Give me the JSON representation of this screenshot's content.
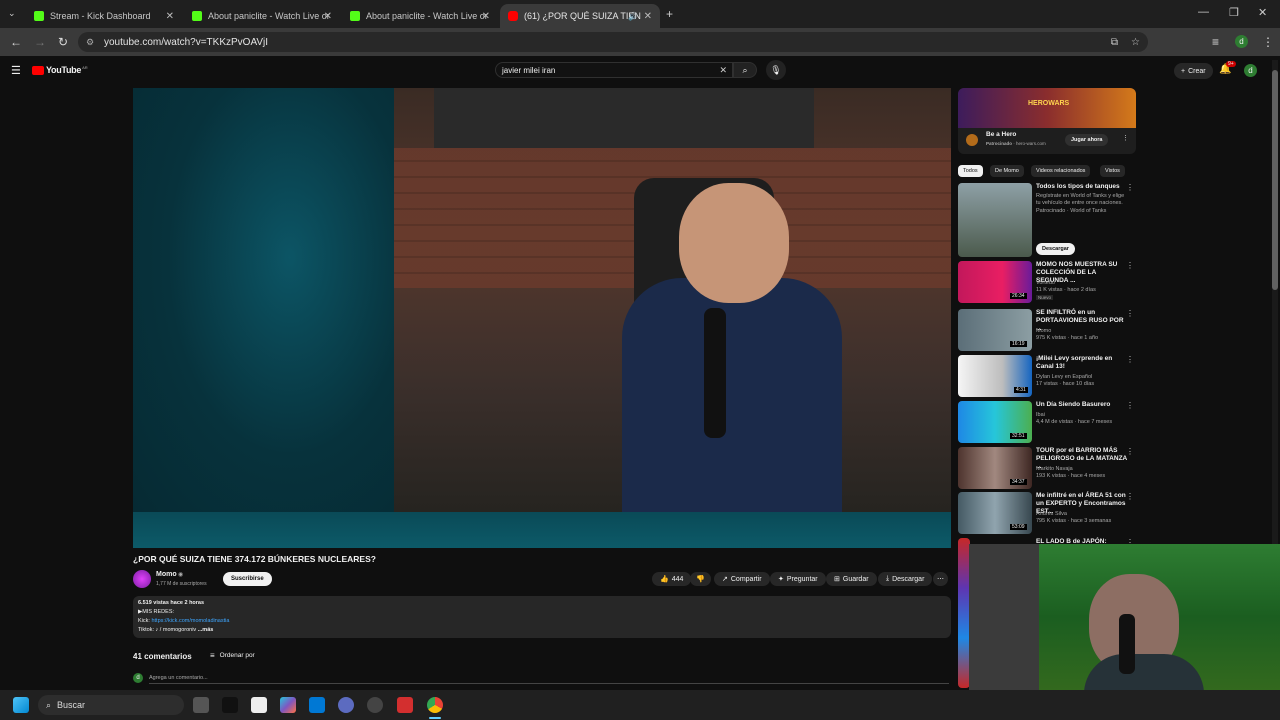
{
  "tabs": [
    {
      "label": "Stream - Kick Dashboard"
    },
    {
      "label": "About paniclite - Watch Live or"
    },
    {
      "label": "About paniclite - Watch Live or"
    },
    {
      "label": "(61) ¿POR QUÉ SUIZA TIEN"
    }
  ],
  "colors": {
    "kick": "#53fc18",
    "youtube_red": "#ff0000",
    "accent_blue": "#3ea6ff"
  },
  "address": {
    "url": "youtube.com/watch?v=TKKzPvOAVjI"
  },
  "youtube": {
    "logo_text": "YouTube",
    "logo_super": "AR",
    "search_query": "javier milei iran",
    "create_label": "Crear",
    "notif_count": "9+"
  },
  "video": {
    "title": "¿POR QUÉ SUIZA TIENE 374.172 BÚNKERES NUCLEARES?",
    "channel": "Momo",
    "subscribers": "1,77 M de suscriptores",
    "subscribe_label": "Suscribirse",
    "likes": "444",
    "share_label": "Compartir",
    "ask_label": "Preguntar",
    "save_label": "Guardar",
    "download_label": "Descargar"
  },
  "description": {
    "views_time": "6.519 vistas  hace 2 horas",
    "line1": "▶MIS REDES:",
    "kick_label": "Kick:",
    "kick_link": "https://kick.com/momoladinastia",
    "tiktok_label": "Tiktok:",
    "tiktok_value": "♪ / momogoroniv",
    "more": "...más"
  },
  "comments": {
    "count_label": "41 comentarios",
    "sort_label": "Ordenar por",
    "add_placeholder": "Agrega un comentario..."
  },
  "ad": {
    "banner_text": "HEROWARS",
    "title": "Be a Hero",
    "sponsored": "Patrocinado",
    "domain": "hero-wars.com",
    "cta": "Jugar ahora"
  },
  "filters": [
    "Todos",
    "De Momo",
    "Videos relacionados",
    "Vistos"
  ],
  "sidebar": [
    {
      "title": "Todos los tipos de tanques",
      "line2": "Regístrate en World of Tanks y elige",
      "line3": "tu vehículo de entre once naciones.",
      "meta": "Patrocinado · World of Tanks",
      "button": "Descargar",
      "duration": ""
    },
    {
      "title": "MOMO NOS MUESTRA SU COLECCIÓN DE LA SEGUNDA ...",
      "channel": "Vortedo",
      "meta": "11 K vistas · hace 2 días",
      "badge": "Nuevo",
      "duration": "26:34"
    },
    {
      "title": "SE INFILTRÓ en un PORTAAVIONES RUSO POR ...",
      "channel": "Momo",
      "meta": "975 K vistas · hace 1 año",
      "duration": "16:19"
    },
    {
      "title": "¡Milei Levy sorprende en Canal 13!",
      "channel": "Dylan Levy en Español",
      "meta": "17 vistas · hace 10 días",
      "duration": "4:31"
    },
    {
      "title": "Un Día Siendo Basurero",
      "channel": "Ibai",
      "meta": "4,4 M de vistas · hace 7 meses",
      "duration": "32:51"
    },
    {
      "title": "TOUR por el BARRIO MÁS PELIGROSO de LA MATANZA ...",
      "channel": "Markito Navaja",
      "meta": "193 K vistas · hace 4 meses",
      "duration": "34:37"
    },
    {
      "title": "Me infiltré en el ÁREA 51 con un EXPERTO y Encontramos EST...",
      "channel": "Andrés Silva",
      "meta": "795 K vistas · hace 3 semanas",
      "duration": "53:09"
    },
    {
      "title": "EL LADO B de JAPÓN:",
      "channel": "",
      "meta": "",
      "duration": ""
    }
  ],
  "taskbar": {
    "search_label": "Buscar"
  }
}
